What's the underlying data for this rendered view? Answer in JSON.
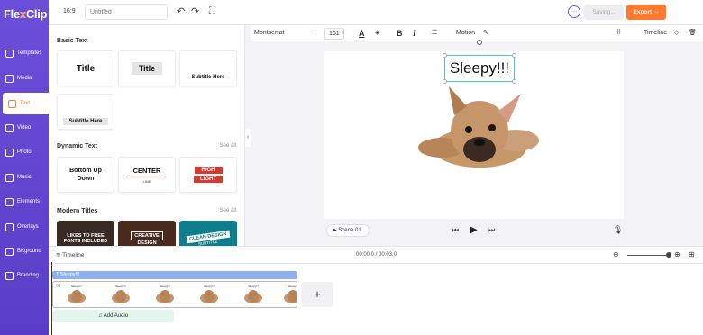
{
  "app": {
    "logo_prefix": "Fle",
    "logo_x": "x",
    "logo_suffix": "Clip"
  },
  "sidebar": {
    "items": [
      {
        "label": "Templates"
      },
      {
        "label": "Media"
      },
      {
        "label": "Text"
      },
      {
        "label": "Video"
      },
      {
        "label": "Photo"
      },
      {
        "label": "Music"
      },
      {
        "label": "Elements"
      },
      {
        "label": "Overlays"
      },
      {
        "label": "BKground"
      },
      {
        "label": "Branding"
      }
    ]
  },
  "topbar": {
    "ratio": "16:9",
    "title_placeholder": "Untitled",
    "saving_label": "Saving...",
    "export_label": "Export"
  },
  "panel": {
    "basic_text_heading": "Basic Text",
    "basic_cards": [
      "Title",
      "Title",
      "Subtitle Here",
      "Subtitle Here"
    ],
    "dynamic_text_heading": "Dynamic Text",
    "dynamic_see_all": "See all",
    "dynamic_cards": [
      {
        "line1": "Bottom Up",
        "line2": "Down"
      },
      {
        "line1": "CENTER",
        "line2": "LINE"
      },
      {
        "line1": "HIGH",
        "line2": "LIGHT"
      }
    ],
    "modern_titles_heading": "Modern Titles",
    "modern_see_all": "See all",
    "modern_cards": [
      {
        "line1": "LIKES TO FREE",
        "line2": "FONTS INCLUDED"
      },
      {
        "line1": "CREATIVE",
        "line2": "DESIGN"
      },
      {
        "line1": "CLEAN DESIGN",
        "line2": "SUBTITLE"
      }
    ]
  },
  "toolbar": {
    "font": "Montserrat",
    "size": "101",
    "minus": "−",
    "plus": "+",
    "motion_label": "Motion",
    "timeline_label": "Timeline"
  },
  "canvas": {
    "text": "Sleepy!!!"
  },
  "player": {
    "scene_label": "Scene 01"
  },
  "timeline": {
    "label": "Timeline",
    "timecode": "00:00.0 / 00:03.0",
    "text_track": "Sleepy!!!",
    "audio_label": "Add Audio",
    "add_label": "+",
    "frame_caption": "Sleepy!!!",
    "frames": 6
  },
  "colors": {
    "sidebar": "#5a3ec7",
    "accent": "#ff7a2f",
    "selection": "#45c6d8"
  }
}
